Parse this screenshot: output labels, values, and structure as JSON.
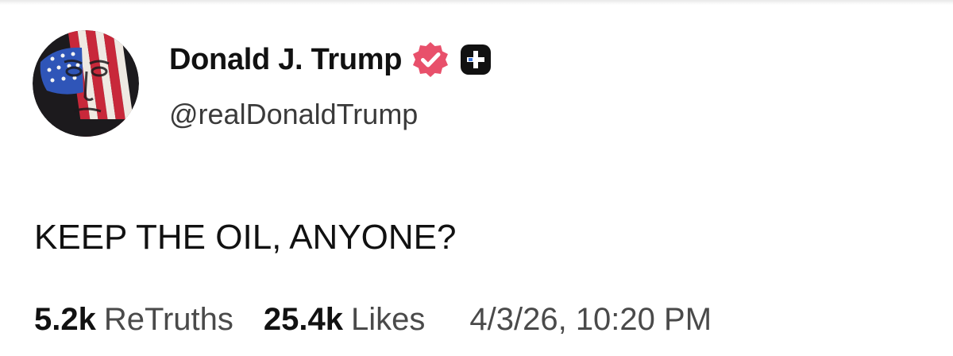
{
  "author": {
    "display_name": "Donald J. Trump",
    "handle": "@realDonaldTrump",
    "verified_color": "#e8506b",
    "avatar_icon": "flag-face-avatar",
    "verified_icon": "verified-check-icon",
    "plus_icon": "plus-badge-icon"
  },
  "post": {
    "text": "KEEP THE OIL, ANYONE?"
  },
  "stats": {
    "retruths_count": "5.2k",
    "retruths_label": "ReTruths",
    "likes_count": "25.4k",
    "likes_label": "Likes",
    "timestamp": "4/3/26, 10:20 PM"
  }
}
